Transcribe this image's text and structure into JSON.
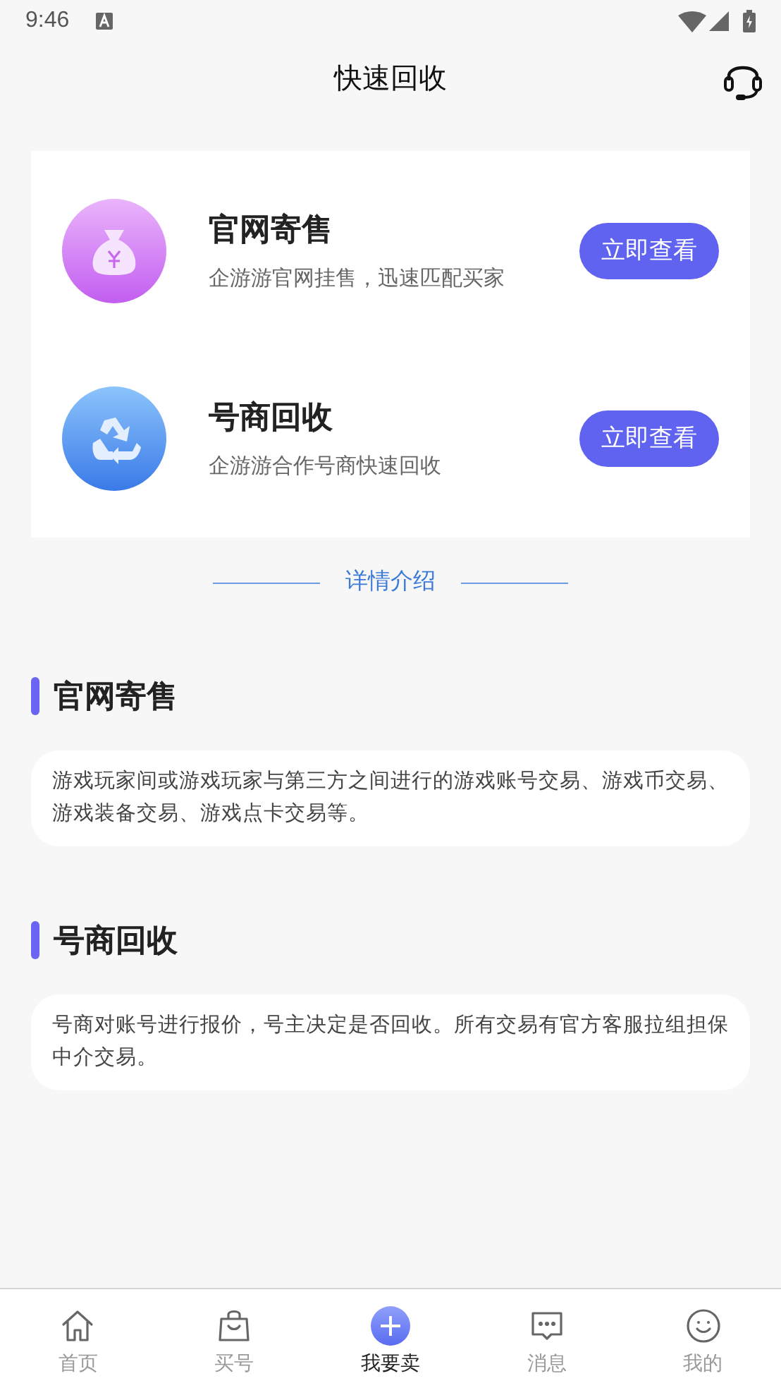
{
  "status_bar": {
    "time": "9:46"
  },
  "header": {
    "title": "快速回收"
  },
  "options": [
    {
      "kind": "money",
      "title": "官网寄售",
      "subtitle": "企游游官网挂售，迅速匹配买家",
      "button": "立即查看"
    },
    {
      "kind": "recycle",
      "title": "号商回收",
      "subtitle": "企游游合作号商快速回收",
      "button": "立即查看"
    }
  ],
  "details_divider": "详情介绍",
  "sections": [
    {
      "heading": "官网寄售",
      "description": "游戏玩家间或游戏玩家与第三方之间进行的游戏账号交易、游戏币交易、游戏装备交易、游戏点卡交易等。"
    },
    {
      "heading": "号商回收",
      "description": "号商对账号进行报价，号主决定是否回收。所有交易有官方客服拉组担保中介交易。"
    }
  ],
  "bottom_nav": [
    {
      "kind": "home",
      "label": "首页",
      "selected": false
    },
    {
      "kind": "bag",
      "label": "买号",
      "selected": false
    },
    {
      "kind": "plus",
      "label": "我要卖",
      "selected": true
    },
    {
      "kind": "chat",
      "label": "消息",
      "selected": false
    },
    {
      "kind": "smile",
      "label": "我的",
      "selected": false
    }
  ]
}
